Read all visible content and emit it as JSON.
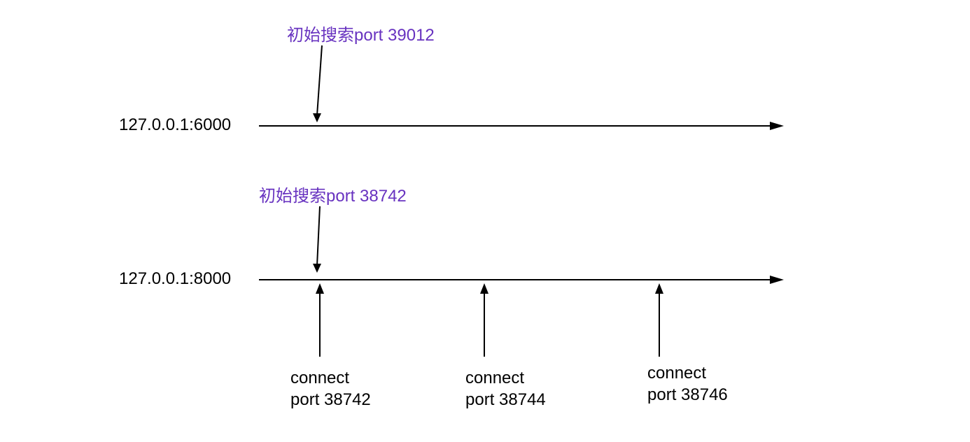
{
  "timelines": [
    {
      "address": "127.0.0.1:6000",
      "initialSearchLabel": "初始搜索port 39012"
    },
    {
      "address": "127.0.0.1:8000",
      "initialSearchLabel": "初始搜索port 38742",
      "connections": [
        {
          "line1": "connect",
          "line2": "port 38742"
        },
        {
          "line1": "connect",
          "line2": "port 38744"
        },
        {
          "line1": "connect",
          "line2": "port 38746"
        }
      ]
    }
  ]
}
